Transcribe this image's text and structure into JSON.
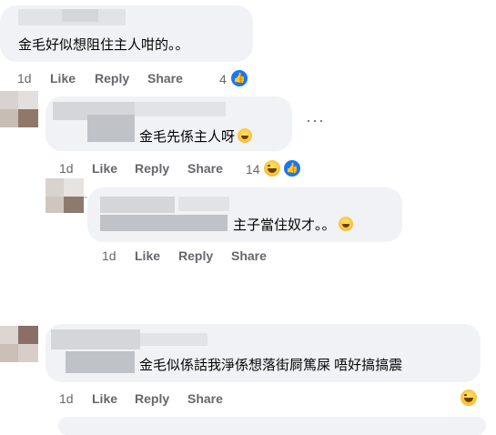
{
  "comments": [
    {
      "text": "金毛好似想阻住主人咁的。。",
      "time": "1d",
      "like": "Like",
      "reply": "Reply",
      "share": "Share",
      "reaction_count": "4",
      "reactions": [
        "like-icon"
      ]
    },
    {
      "text": "金毛先係主人呀",
      "time": "1d",
      "like": "Like",
      "reply": "Reply",
      "share": "Share",
      "reaction_count": "14",
      "reactions": [
        "haha-icon",
        "like-icon"
      ]
    },
    {
      "text": "主子當住奴才。。",
      "time": "1d",
      "like": "Like",
      "reply": "Reply",
      "share": "Share"
    },
    {
      "text": "金毛似係話我淨係想落街屙篤屎 唔好搞搞震",
      "time": "1d",
      "like": "Like",
      "reply": "Reply",
      "share": "Share",
      "reactions": [
        "haha-icon"
      ]
    }
  ],
  "colors": {
    "bubble": "#f0f2f5",
    "meta": "#65676b",
    "like_blue": "#1877f2"
  }
}
